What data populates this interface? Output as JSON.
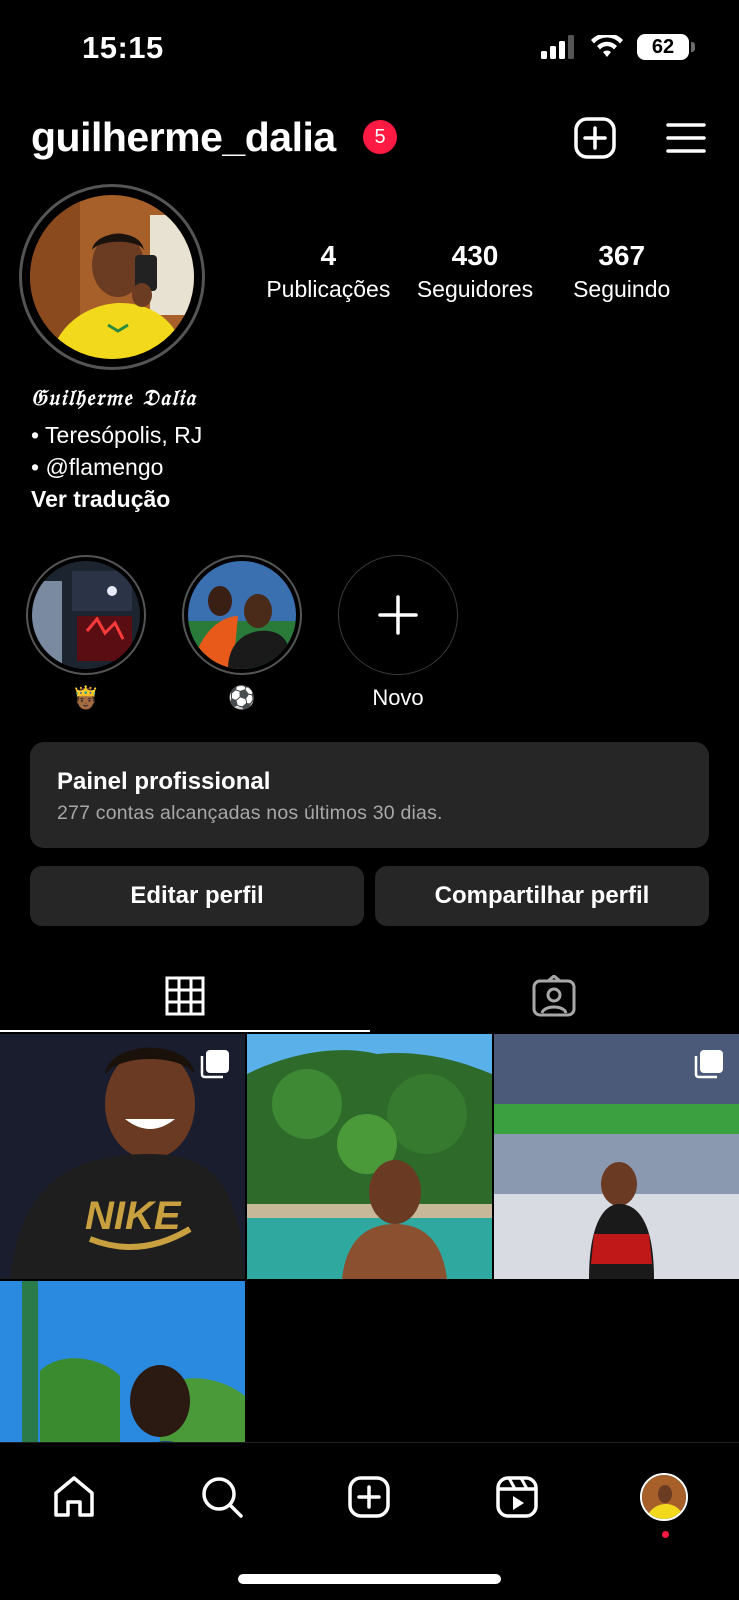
{
  "status": {
    "time": "15:15",
    "battery": "62",
    "icons": [
      "signal-icon",
      "wifi-icon",
      "battery-icon"
    ]
  },
  "header": {
    "username": "guilherme_dalia",
    "notification_count": "5",
    "icons": [
      "create-icon",
      "menu-icon"
    ]
  },
  "profile": {
    "stats": [
      {
        "value": "4",
        "label": "Publicações"
      },
      {
        "value": "430",
        "label": "Seguidores"
      },
      {
        "value": "367",
        "label": "Seguindo"
      }
    ],
    "display_name": "𝔊𝔲𝔦𝔩𝔥𝔢𝔯𝔪𝔢 𝔇𝔞𝔩𝔦𝔞",
    "bio_lines": [
      "• Teresópolis, RJ",
      "• @flamengo"
    ],
    "translate_label": "Ver tradução"
  },
  "highlights": [
    {
      "label": "🤴🏾"
    },
    {
      "label": "⚽️"
    },
    {
      "label": "Novo"
    }
  ],
  "dashboard": {
    "title": "Painel profissional",
    "subtitle": "277 contas alcançadas nos últimos 30 dias."
  },
  "actions": {
    "edit_label": "Editar perfil",
    "share_label": "Compartilhar perfil"
  },
  "tabs": [
    "grid-icon",
    "tagged-icon"
  ],
  "nav": [
    "home-icon",
    "search-icon",
    "create-icon",
    "reels-icon",
    "profile-avatar"
  ],
  "colors": {
    "background": "#000000",
    "surface": "#262626",
    "badge": "#ff1a44",
    "muted_text": "#a8a8a8"
  }
}
